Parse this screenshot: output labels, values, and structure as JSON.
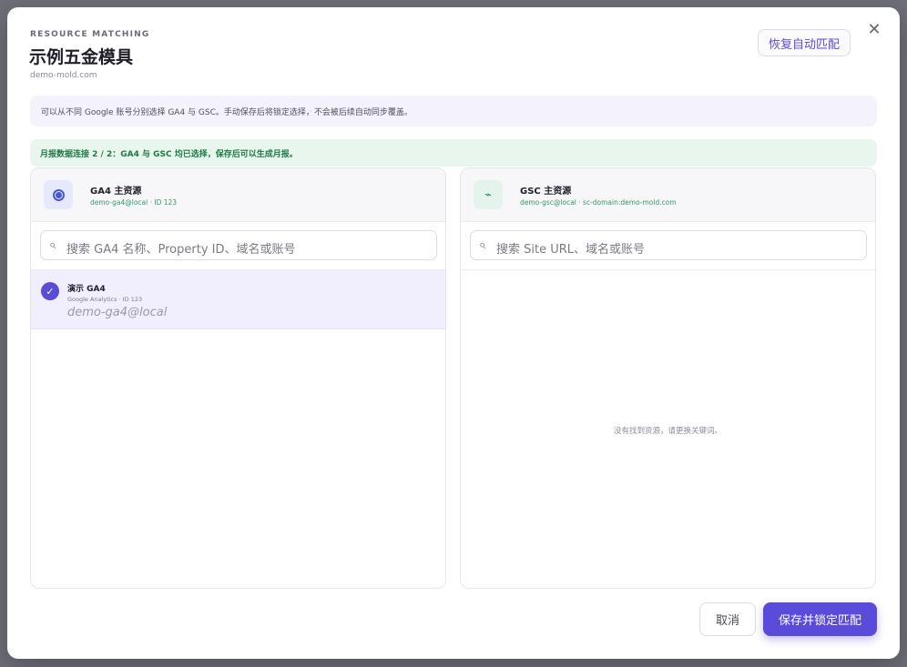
{
  "header": {
    "eyebrow": "RESOURCE MATCHING",
    "title": "示例五金模具",
    "domain": "demo-mold.com",
    "restore_label": "恢复自动匹配",
    "close_icon": "close-icon"
  },
  "info": "可以从不同 Google 账号分别选择 GA4 与 GSC。手动保存后将锁定选择，不会被后续自动同步覆盖。",
  "status": "月报数据连接 2 / 2：GA4 与 GSC 均已选择，保存后可以生成月报。",
  "ga4_panel": {
    "title": "GA4 主资源",
    "subtitle": "demo-ga4@local · ID 123",
    "search_placeholder": "搜索 GA4 名称、Property ID、域名或账号",
    "items": [
      {
        "title": "演示 GA4",
        "meta": "Google Analytics · ID 123",
        "account": "demo-ga4@local",
        "selected": true
      }
    ]
  },
  "gsc_panel": {
    "title": "GSC 主资源",
    "subtitle": "demo-gsc@local · sc-domain:demo-mold.com",
    "search_placeholder": "搜索 Site URL、域名或账号",
    "empty_text": "没有找到资源，请更换关键词。"
  },
  "footer": {
    "cancel_label": "取消",
    "save_label": "保存并锁定匹配"
  },
  "colors": {
    "accent": "#5b4bdb",
    "success": "#1f7a46",
    "info_bg": "#f3f2fd",
    "success_bg": "#e8f6ee"
  }
}
